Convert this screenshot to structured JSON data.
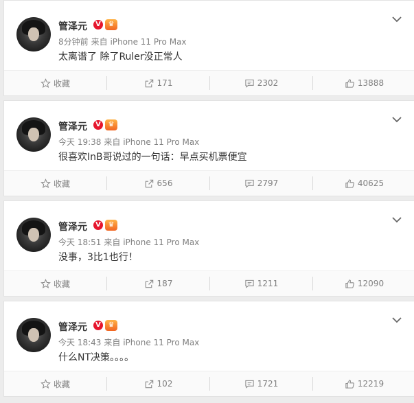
{
  "posts": [
    {
      "username": "管泽元",
      "verified_badge": "V",
      "time": "8分钟前",
      "source": "来自 iPhone 11 Pro Max",
      "content": "太离谱了 除了Ruler没正常人",
      "favorite_label": "收藏",
      "reposts": "171",
      "comments": "2302",
      "likes": "13888"
    },
    {
      "username": "管泽元",
      "verified_badge": "V",
      "time": "今天 19:38",
      "source": "来自 iPhone 11 Pro Max",
      "content": "很喜欢InB哥说过的一句话：早点买机票便宜",
      "favorite_label": "收藏",
      "reposts": "656",
      "comments": "2797",
      "likes": "40625"
    },
    {
      "username": "管泽元",
      "verified_badge": "V",
      "time": "今天 18:51",
      "source": "来自 iPhone 11 Pro Max",
      "content": "没事，3比1也行！",
      "favorite_label": "收藏",
      "reposts": "187",
      "comments": "1211",
      "likes": "12090"
    },
    {
      "username": "管泽元",
      "verified_badge": "V",
      "time": "今天 18:43",
      "source": "来自 iPhone 11 Pro Max",
      "content": "什么NT决策。。。。",
      "favorite_label": "收藏",
      "reposts": "102",
      "comments": "1721",
      "likes": "12219"
    }
  ],
  "icons": {
    "favorite": "star-outline-icon",
    "repost": "share-arrow-icon",
    "comment": "comment-bubble-icon",
    "like": "thumbs-up-icon",
    "menu": "chevron-down-icon",
    "verified": "verified-v-icon",
    "vip": "vip-crown-icon"
  },
  "colors": {
    "verified_badge": "#e6162d",
    "vip_badge": "#f26522",
    "meta_text": "#808080",
    "card_background": "#ffffff",
    "page_background": "#ececec"
  }
}
